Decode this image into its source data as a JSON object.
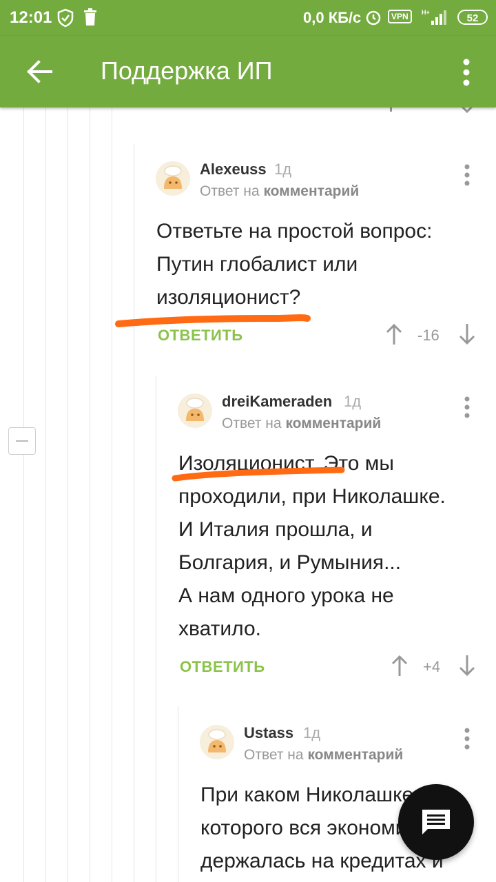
{
  "status": {
    "time": "12:01",
    "speed": "0,0 КБ/с",
    "vpn": "VPN",
    "battery": "52"
  },
  "header": {
    "title": "Поддержка ИП"
  },
  "comments": [
    {
      "author": "Alexeuss",
      "age": "1д",
      "reply_prefix": "Ответ на",
      "reply_target": "комментарий",
      "lines": [
        "Ответьте на простой вопрос:",
        "Путин глобалист или",
        "изоляционист?"
      ],
      "reply_label": "ОТВЕТИТЬ",
      "score": "-16"
    },
    {
      "author": "dreiKameraden",
      "age": "1д",
      "reply_prefix": "Ответ на",
      "reply_target": "комментарий",
      "lines": [
        "Изоляционист. Это мы",
        "проходили, при Николашке.",
        "И Италия прошла, и",
        "Болгария, и Румыния...",
        "А нам одного урока не",
        "хватило."
      ],
      "reply_label": "ОТВЕТИТЬ",
      "score": "+4"
    },
    {
      "author": "Ustass",
      "age": "1д",
      "reply_prefix": "Ответ на",
      "reply_target": "комментарий",
      "lines": [
        "При каком Николашке, у",
        "которого вся экономика",
        "держалась на кредитах и"
      ]
    }
  ],
  "colors": {
    "appbar": "#74ab3e",
    "reply_button": "#8bc34a",
    "highlight": "#ff6a13"
  },
  "icons": {
    "back": "arrow-left-icon",
    "menu": "more-vertical-icon",
    "fab": "chat-icon"
  }
}
